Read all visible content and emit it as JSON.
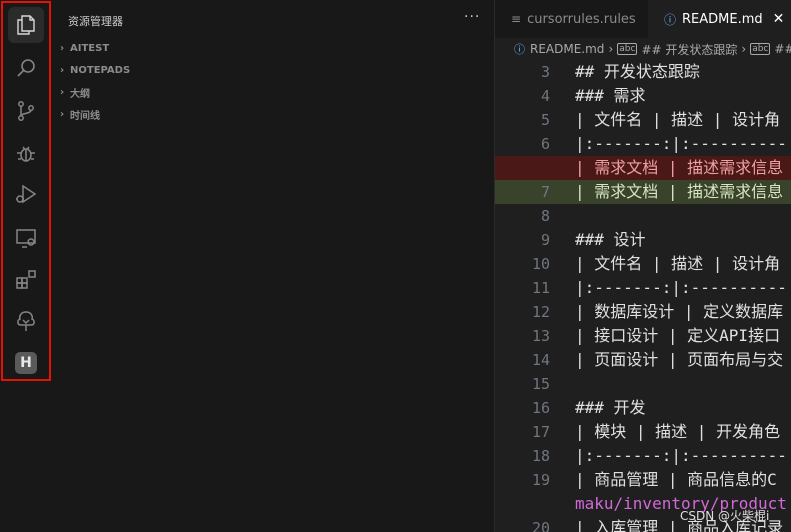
{
  "sidebar": {
    "title": "资源管理器",
    "more": "···",
    "sections": [
      {
        "label": "AITEST"
      },
      {
        "label": "NOTEPADS"
      },
      {
        "label": "大纲"
      },
      {
        "label": "时间线"
      }
    ]
  },
  "activity_bar": {
    "items": [
      "explorer",
      "search",
      "source-control",
      "debug",
      "run-debug",
      "remote-explorer",
      "extensions",
      "tree-view",
      "h-extension"
    ],
    "h_label": "H",
    "highlight_color": "#e51400"
  },
  "tabs": [
    {
      "label": "cursorrules.rules",
      "icon": "≡"
    },
    {
      "label": "README.md",
      "icon": "ⓘ",
      "close": "✕"
    }
  ],
  "breadcrumb": {
    "file": "README.md",
    "item1": "## 开发状态跟踪",
    "item2": "###",
    "md_icon": "abc"
  },
  "code_lines": [
    {
      "num": "3",
      "text": "## 开发状态跟踪"
    },
    {
      "num": "4",
      "text": "### 需求"
    },
    {
      "num": "5",
      "text": "| 文件名 | 描述 | 设计角"
    },
    {
      "num": "6",
      "text": "|:-------:|:----------"
    },
    {
      "num": "",
      "text": "| 需求文档 | 描述需求信息"
    },
    {
      "num": "7",
      "text": "| 需求文档 | 描述需求信息"
    },
    {
      "num": "8",
      "text": ""
    },
    {
      "num": "9",
      "text": "### 设计"
    },
    {
      "num": "10",
      "text": "| 文件名 | 描述 | 设计角"
    },
    {
      "num": "11",
      "text": "|:-------:|:----------"
    },
    {
      "num": "12",
      "text": "| 数据库设计 | 定义数据库"
    },
    {
      "num": "13",
      "text": "| 接口设计 | 定义API接口"
    },
    {
      "num": "14",
      "text": "| 页面设计 | 页面布局与交"
    },
    {
      "num": "15",
      "text": ""
    },
    {
      "num": "16",
      "text": "### 开发"
    },
    {
      "num": "17",
      "text": "| 模块 | 描述 | 开发角色"
    },
    {
      "num": "18",
      "text": "|:-------:|:----------"
    },
    {
      "num": "19",
      "text": "| 商品管理 | 商品信息的C"
    },
    {
      "num": "",
      "text": "maku/inventory/product"
    },
    {
      "num": "20",
      "text": "| 入库管理 | 商品入库记录"
    }
  ],
  "watermark": "CSDN @火柴棍i"
}
